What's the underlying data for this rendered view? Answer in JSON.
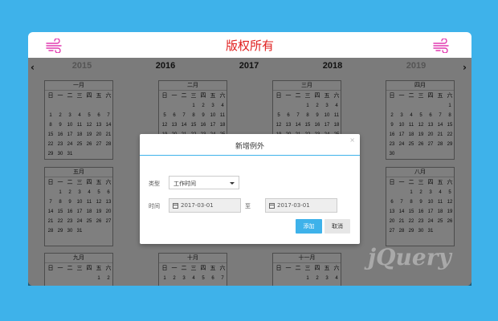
{
  "header": {
    "title": "版权所有"
  },
  "colors": {
    "background": "#3eb2ea",
    "accent": "#3eb2ea",
    "title": "#e0201f",
    "icon": "#e23ab0"
  },
  "icons": {
    "left": "wind-icon",
    "right": "wind-icon",
    "prev": "chevron-left-icon",
    "next": "chevron-right-icon",
    "date": "calendar-icon"
  },
  "years": {
    "prev_arrow": "‹",
    "next_arrow": "›",
    "items": [
      "2015",
      "2016",
      "2017",
      "2018",
      "2019"
    ],
    "selected": "2017"
  },
  "weekdays": [
    "日",
    "一",
    "二",
    "三",
    "四",
    "五",
    "六"
  ],
  "months": [
    {
      "name": "一月",
      "rows": [
        [
          "",
          "",
          "",
          "",
          "",
          "",
          ""
        ],
        [
          "1",
          "2",
          "3",
          "4",
          "5",
          "6",
          "7"
        ],
        [
          "8",
          "9",
          "10",
          "11",
          "12",
          "13",
          "14"
        ],
        [
          "15",
          "16",
          "17",
          "18",
          "19",
          "20",
          "21"
        ],
        [
          "22",
          "23",
          "24",
          "25",
          "26",
          "27",
          "28"
        ],
        [
          "29",
          "30",
          "31",
          "",
          "",
          "",
          ""
        ]
      ]
    },
    {
      "name": "二月",
      "rows": [
        [
          "",
          "",
          "",
          "1",
          "2",
          "3",
          "4"
        ],
        [
          "5",
          "6",
          "7",
          "8",
          "9",
          "10",
          "11"
        ],
        [
          "12",
          "13",
          "14",
          "15",
          "16",
          "17",
          "18"
        ],
        [
          "19",
          "20",
          "21",
          "22",
          "23",
          "24",
          "25"
        ],
        [
          "26",
          "27",
          "28",
          "",
          "",
          "",
          ""
        ],
        [
          "",
          "",
          "",
          "",
          "",
          "",
          ""
        ]
      ]
    },
    {
      "name": "三月",
      "rows": [
        [
          "",
          "",
          "",
          "1",
          "2",
          "3",
          "4"
        ],
        [
          "5",
          "6",
          "7",
          "8",
          "9",
          "10",
          "11"
        ],
        [
          "12",
          "13",
          "14",
          "15",
          "16",
          "17",
          "18"
        ],
        [
          "19",
          "20",
          "21",
          "22",
          "23",
          "24",
          "25"
        ],
        [
          "26",
          "27",
          "28",
          "29",
          "30",
          "31",
          ""
        ],
        [
          "",
          "",
          "",
          "",
          "",
          "",
          ""
        ]
      ]
    },
    {
      "name": "四月",
      "rows": [
        [
          "",
          "",
          "",
          "",
          "",
          "",
          "1"
        ],
        [
          "2",
          "3",
          "4",
          "5",
          "6",
          "7",
          "8"
        ],
        [
          "9",
          "10",
          "11",
          "12",
          "13",
          "14",
          "15"
        ],
        [
          "16",
          "17",
          "18",
          "19",
          "20",
          "21",
          "22"
        ],
        [
          "23",
          "24",
          "25",
          "26",
          "27",
          "28",
          "29"
        ],
        [
          "30",
          "",
          "",
          "",
          "",
          "",
          ""
        ]
      ]
    },
    {
      "name": "五月",
      "rows": [
        [
          "",
          "1",
          "2",
          "3",
          "4",
          "5",
          "6"
        ],
        [
          "7",
          "8",
          "9",
          "10",
          "11",
          "12",
          "13"
        ],
        [
          "14",
          "15",
          "16",
          "17",
          "18",
          "19",
          "20"
        ],
        [
          "21",
          "22",
          "23",
          "24",
          "25",
          "26",
          "27"
        ],
        [
          "28",
          "29",
          "30",
          "31",
          "",
          "",
          ""
        ],
        [
          "",
          "",
          "",
          "",
          "",
          "",
          ""
        ]
      ]
    },
    {
      "name": "八月",
      "rows": [
        [
          "",
          "",
          "1",
          "2",
          "3",
          "4",
          "5"
        ],
        [
          "6",
          "7",
          "8",
          "9",
          "10",
          "11",
          "12"
        ],
        [
          "13",
          "14",
          "15",
          "16",
          "17",
          "18",
          "19"
        ],
        [
          "20",
          "21",
          "22",
          "23",
          "24",
          "25",
          "26"
        ],
        [
          "27",
          "28",
          "29",
          "30",
          "31",
          "",
          ""
        ],
        [
          "",
          "",
          "",
          "",
          "",
          "",
          ""
        ]
      ]
    },
    {
      "name": "九月",
      "rows": [
        [
          "",
          "",
          "",
          "",
          "",
          "1",
          "2"
        ]
      ]
    },
    {
      "name": "十月",
      "rows": [
        [
          "1",
          "2",
          "3",
          "4",
          "5",
          "6",
          "7"
        ]
      ]
    },
    {
      "name": "十一月",
      "rows": [
        [
          "",
          "",
          "",
          "1",
          "2",
          "3",
          "4"
        ]
      ]
    }
  ],
  "dialog": {
    "title": "新增例外",
    "close": "×",
    "type_label": "类型",
    "type_value": "工作时间",
    "time_label": "时间",
    "start_date": "2017-03-01",
    "to_label": "至",
    "end_date": "2017-03-01",
    "add_label": "添加",
    "cancel_label": "取消"
  }
}
